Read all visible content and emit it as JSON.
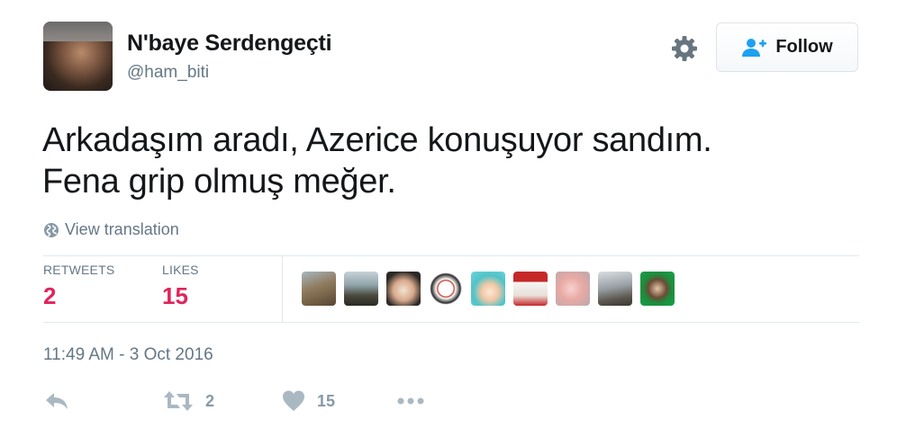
{
  "author": {
    "display_name": "N'baye Serdengeçti",
    "handle": "@ham_biti"
  },
  "header": {
    "settings_icon": "gear-icon",
    "follow_label": "Follow",
    "follow_icon": "add-user-icon"
  },
  "tweet": {
    "text_line_1": "Arkadaşım aradı, Azerice konuşuyor sandım.",
    "text_line_2": "Fena grip olmuş meğer.",
    "translate_label": "View translation",
    "translate_icon": "globe-icon",
    "timestamp": "11:49 AM - 3 Oct 2016"
  },
  "stats": {
    "retweets_label": "RETWEETS",
    "retweets_count": "2",
    "likes_label": "LIKES",
    "likes_count": "15",
    "accent_color": "#e0245e"
  },
  "likers": [
    {
      "name": "liker-avatar-1"
    },
    {
      "name": "liker-avatar-2"
    },
    {
      "name": "liker-avatar-3"
    },
    {
      "name": "liker-avatar-4"
    },
    {
      "name": "liker-avatar-5"
    },
    {
      "name": "liker-avatar-6"
    },
    {
      "name": "liker-avatar-7"
    },
    {
      "name": "liker-avatar-8"
    },
    {
      "name": "liker-avatar-9"
    }
  ],
  "actions": {
    "reply_icon": "reply-icon",
    "retweet_icon": "retweet-icon",
    "retweet_count": "2",
    "like_icon": "heart-icon",
    "like_count": "15",
    "more_icon": "more-icon"
  },
  "colors": {
    "text_primary": "#14171a",
    "text_secondary": "#657786",
    "action_gray": "#8899a6",
    "divider": "#e1e8ed"
  }
}
